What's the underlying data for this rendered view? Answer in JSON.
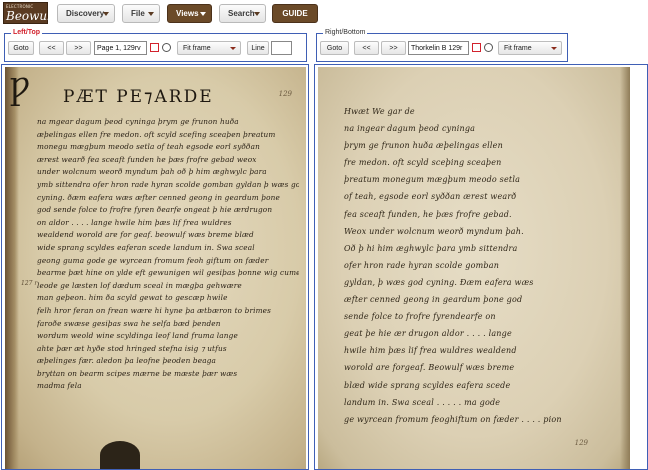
{
  "toolbar": {
    "logo_small": "ELECTRONIC",
    "logo_big": "Beowulf",
    "discovery": "Discovery",
    "file": "File",
    "views": "Views",
    "search": "Search",
    "guide": "GUIDE"
  },
  "left_panel": {
    "legend": "Left/Top",
    "goto": "Goto",
    "prev": "<<",
    "next": ">>",
    "page_value": "Page 1, 129rv",
    "fit": "Fit frame",
    "line_label": "Line",
    "line_value": ""
  },
  "right_panel": {
    "legend": "Right/Bottom",
    "goto": "Goto",
    "prev": "<<",
    "next": ">>",
    "page_value": "Thorkelin B 129r",
    "fit": "Fit frame"
  },
  "left_image": {
    "initial": "Ƿ",
    "heading": "PÆT PE⁊ARDE",
    "folio_top": "129",
    "margin_mark": "127 r",
    "lines": [
      "na mgear dagum þeod cyninga þrym ge frunon huða",
      "æþelingas ellen fre medon. oft scyld scefing sceaþen þreatum",
      "monegu mægþum meodo setla of teah egsode eorl syððan",
      "ærest wearð fea sceaft funden he þæs frofre gebad weox",
      "under wolcnum weorð myndum þah oð þ him æghwylc þara",
      "ymb sittendra ofer hron rade hyran scolde gomban gyldan þ wæs god",
      "cyning. ðæm eafera wæs æfter cenned geong in geardum þone",
      "god sende folce to frofre fyren ðearfe ongeat þ hie ærdrugon",
      "on aldor . . . . lange hwile him þæs lif frea wuldres",
      "wealdend worold are for geaf. beowulf wæs breme blæd",
      "wide sprang scyldes eaferan scede landum in. Swa sceal",
      "geong guma gode ge wyrcean fromum feoh giftum on fæder",
      "bearme þæt hine on ylde eft gewunigen wil gesiþas þonne wig cume",
      "leode ge læsten lof dædum sceal in mægþa gehwære",
      "man geþeon. him ða scyld gewat to gescæp hwile",
      "felh hror feran on frean wære hi hyne þa ætbæron to brimes",
      "faroðe swæse gesiþas swa he selfa bæd þenden",
      "wordum weold wine scyldinga leof land fruma lange",
      "ahte þær æt hyðe stod hringed stefna isig ⁊ utfus",
      "æþelinges fær. aledon þa leofne þeoden beaga",
      "bryttan on bearm scipes mærne be mæste þær wæs",
      "madma fela"
    ]
  },
  "right_image": {
    "folio_bottom": "129",
    "lines": [
      "Hwæt We gar de",
      "na ingear dagum þeod cyninga",
      "þrym ge frunon huða æþelingas ellen",
      "fre medon. oft scyld sceþing sceaþen",
      "þreatum monegum mægþum meodo setla",
      "of teah, egsode eorl syððan ærest wearð",
      "fea sceaft funden, he þæs frofre gebad.",
      "Weox under wolcnum weorð myndum þah.",
      "Oð þ hi him æghwylc þara ymb sittendra",
      "ofer hron rade hyran scolde gomban",
      "gyldan, þ wæs god cyning. Ðæm eafera wæs",
      "æfter cenned geong in geardum þone god",
      "sende folce to frofre fyrendearfe on",
      "geat þe hie ær drugon aldor . . . . lange",
      "hwile him þæs lif frea wuldres wealdend",
      "worold are forgeaf. Beowulf wæs breme",
      "blæd wide sprang scyldes eafera scede",
      "landum in. Swa sceal . . . . . ma gode",
      "ge wyrcean fromum feoghiftum on fæder . . . . pion"
    ]
  }
}
